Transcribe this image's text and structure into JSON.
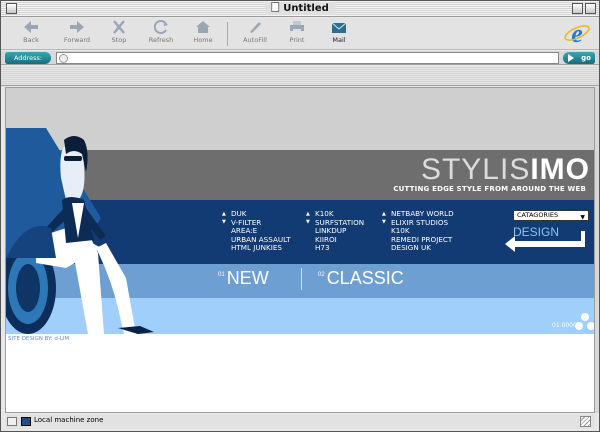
{
  "window": {
    "title": "Untitled"
  },
  "toolbar": {
    "back": "Back",
    "forward": "Forward",
    "stop": "Stop",
    "refresh": "Refresh",
    "home": "Home",
    "autofill": "AutoFill",
    "print": "Print",
    "mail": "Mail"
  },
  "address": {
    "label": "Address:",
    "value": "",
    "go": "go"
  },
  "site": {
    "logo_light": "STYLIS",
    "logo_dark": "IMO",
    "tagline": "CUTTING EDGE STYLE FROM AROUND THE WEB",
    "column1": [
      "DUK",
      "V-FILTER",
      "AREA:E",
      "URBAN ASSAULT",
      "HTML JUNKIES"
    ],
    "column2": [
      "K10K",
      "SURFSTATION",
      "LINKDUP",
      "KIIROI",
      "H73"
    ],
    "column3": [
      "NETBABY WORLD",
      "ELIXIR STUDIOS",
      "K10K",
      "REMEDI PROJECT",
      "DESIGN UK"
    ],
    "category_select": "CATAGORIES",
    "design_label": "DESIGN",
    "nav_new_num": "01",
    "nav_new": "NEW",
    "nav_classic_num": "02",
    "nav_classic": "CLASSIC",
    "counter": "01.0000",
    "credit": "SITE DESIGN BY: d-LIM"
  },
  "status": {
    "zone": "Local machine zone"
  },
  "colors": {
    "accent_teal": "#1d8896",
    "navy": "#123a73",
    "mid_blue": "#6d9fd2",
    "light_blue": "#9fcffa"
  }
}
